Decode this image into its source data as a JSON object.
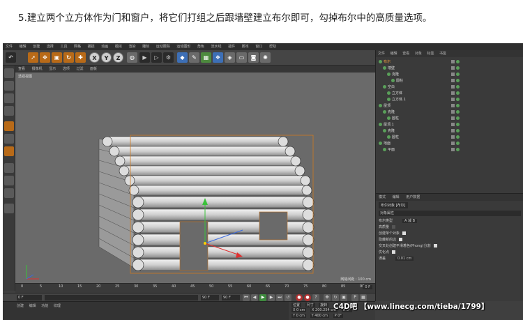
{
  "caption": "5.建立两个立方体作为门和窗户，将它们打组之后跟墙壁建立布尔即可，勾掉布尔中的高质量选项。",
  "menubar": [
    "文件",
    "编辑",
    "创建",
    "选择",
    "工具",
    "网格",
    "捕捉",
    "动画",
    "模拟",
    "渲染",
    "雕刻",
    "运动跟踪",
    "运动图形",
    "角色",
    "流水线",
    "插件",
    "脚本",
    "窗口",
    "帮助"
  ],
  "toolbar_axes": [
    "X",
    "Y",
    "Z"
  ],
  "viewport": {
    "menu": [
      "查看",
      "摄像机",
      "显示",
      "选项",
      "过滤",
      "面板"
    ],
    "label": "透视视图",
    "grid_distance": "网格间距 : 100 cm"
  },
  "timeline": {
    "ticks": [
      "0",
      "5",
      "10",
      "15",
      "20",
      "25",
      "30",
      "35",
      "40",
      "45",
      "50",
      "55",
      "60",
      "65",
      "70",
      "75",
      "80",
      "85",
      "90"
    ],
    "current_frame": "0 F"
  },
  "playbar": {
    "start_field": "0 F",
    "end_field": "90 F",
    "end_field_2": "90 F"
  },
  "materials": {
    "menu": [
      "创建",
      "编辑",
      "功能",
      "纹理"
    ]
  },
  "coordinates": {
    "labels": [
      "位置",
      "尺寸",
      "旋转"
    ],
    "rows": [
      [
        "X 0 cm",
        "X 200.254 cm",
        "H 0°"
      ],
      [
        "Y 0 cm",
        "Y 400 cm",
        "P 0°"
      ],
      [
        "Z 0 cm",
        "Z 208 cm",
        "B 0°"
      ]
    ]
  },
  "object_manager": {
    "menu": [
      "文件",
      "编辑",
      "查看",
      "对象",
      "标签",
      "书签"
    ],
    "items": [
      {
        "name": "布尔",
        "indent": 0
      },
      {
        "name": "墙壁",
        "indent": 1
      },
      {
        "name": "克隆",
        "indent": 2
      },
      {
        "name": "圆柱",
        "indent": 3
      },
      {
        "name": "空白",
        "indent": 1
      },
      {
        "name": "立方体",
        "indent": 2
      },
      {
        "name": "立方体.1",
        "indent": 2
      },
      {
        "name": "屋顶",
        "indent": 0
      },
      {
        "name": "克隆",
        "indent": 1
      },
      {
        "name": "圆柱",
        "indent": 2
      },
      {
        "name": "屋顶.1",
        "indent": 0
      },
      {
        "name": "克隆",
        "indent": 1
      },
      {
        "name": "圆柱",
        "indent": 2
      },
      {
        "name": "地面",
        "indent": 0
      },
      {
        "name": "平面",
        "indent": 1
      }
    ]
  },
  "attribute_manager": {
    "menu": [
      "模式",
      "编辑",
      "用户数据"
    ],
    "object": "布尔对象 [布尔]",
    "tab": "对象属性",
    "rows": [
      {
        "label": "布尔类型",
        "value": "A 减 B"
      },
      {
        "label": "高质量",
        "value": ""
      },
      {
        "label": "创建单个对象",
        "value": ""
      },
      {
        "label": "隐藏新的边",
        "value": ""
      },
      {
        "label": "交叉处创建平滑着色(Phong)分割",
        "value": ""
      },
      {
        "label": "优化点",
        "value": ""
      },
      {
        "label": "误差",
        "value": "0.01 cm"
      }
    ]
  },
  "watermark": "C4D吧 【www.linecg.com/tieba/1799】"
}
